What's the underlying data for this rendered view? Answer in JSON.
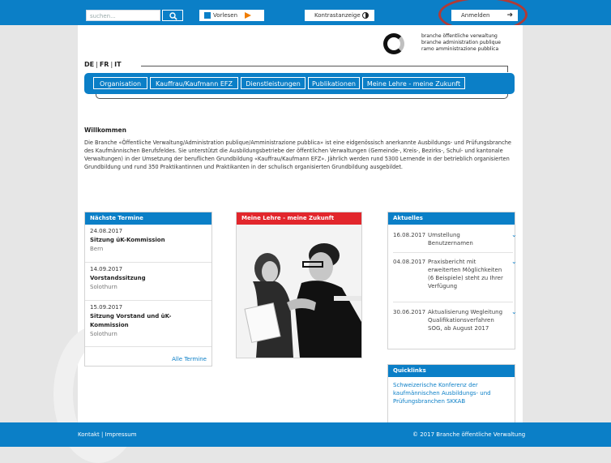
{
  "topbar": {
    "search_placeholder": "suchen...",
    "read_label": "Vorlesen",
    "contrast_label": "Kontrastanzeige",
    "login_label": "Anmelden",
    "accent": "#0b7fc7"
  },
  "brand": {
    "line1": "branche öffentliche verwaltung",
    "line2": "branche administration publique",
    "line3": "ramo amministrazione pubblica"
  },
  "languages": [
    "DE",
    "FR",
    "IT"
  ],
  "nav": {
    "items": [
      "Organisation",
      "Kauffrau/Kaufmann EFZ",
      "Dienstleistungen",
      "Publikationen",
      "Meine Lehre - meine Zukunft"
    ]
  },
  "welcome": {
    "title": "Willkommen",
    "text": "Die Branche «Öffentliche Verwaltung/Administration publique/Amministrazione pubblica» ist eine eidgenössisch anerkannte Ausbildungs- und Prüfungsbranche des Kaufmännischen Berufsfeldes. Sie unterstützt die Ausbildungsbetriebe der öffentlichen Verwaltungen (Gemeinde-, Kreis-, Bezirks-, Schul- und kantonale Verwaltungen) in der Umsetzung der beruflichen Grundbildung «Kauffrau/Kaufmann EFZ». Jährlich werden rund 5300 Lernende in der betrieblich organisierten Grundbildung und rund 350 Praktikantinnen und Praktikanten in der schulisch organisierten Grundbildung ausgebildet."
  },
  "events": {
    "title": "Nächste Termine",
    "items": [
      {
        "date": "24.08.2017",
        "title": "Sitzung üK-Kommission",
        "location": "Bern"
      },
      {
        "date": "14.09.2017",
        "title": "Vorstandssitzung",
        "location": "Solothurn"
      },
      {
        "date": "15.09.2017",
        "title": "Sitzung Vorstand und üK-Kommission",
        "location": "Solothurn"
      }
    ],
    "all_link": "Alle Termine"
  },
  "feature": {
    "title": "Meine Lehre - meine Zukunft",
    "accent": "#e2262c"
  },
  "news": {
    "title": "Aktuelles",
    "items": [
      {
        "date": "16.08.2017",
        "title": "Umstellung Benutzernamen"
      },
      {
        "date": "04.08.2017",
        "title": "Praxisbericht mit erweiterten Möglichkeiten (6 Beispiele) steht zu Ihrer Verfügung"
      },
      {
        "date": "30.06.2017",
        "title": "Aktualisierung Wegleitung Qualifikationsverfahren SOG, ab August 2017"
      }
    ]
  },
  "quicklinks": {
    "title": "Quicklinks",
    "items": [
      "Schweizerische Konferenz der kaufmännischen Ausbildungs- und Prüfungsbranchen SKKAB"
    ]
  },
  "footer": {
    "contact": "Kontakt",
    "imprint": "Impressum",
    "copyright": "© 2017 Branche öffentliche Verwaltung"
  }
}
